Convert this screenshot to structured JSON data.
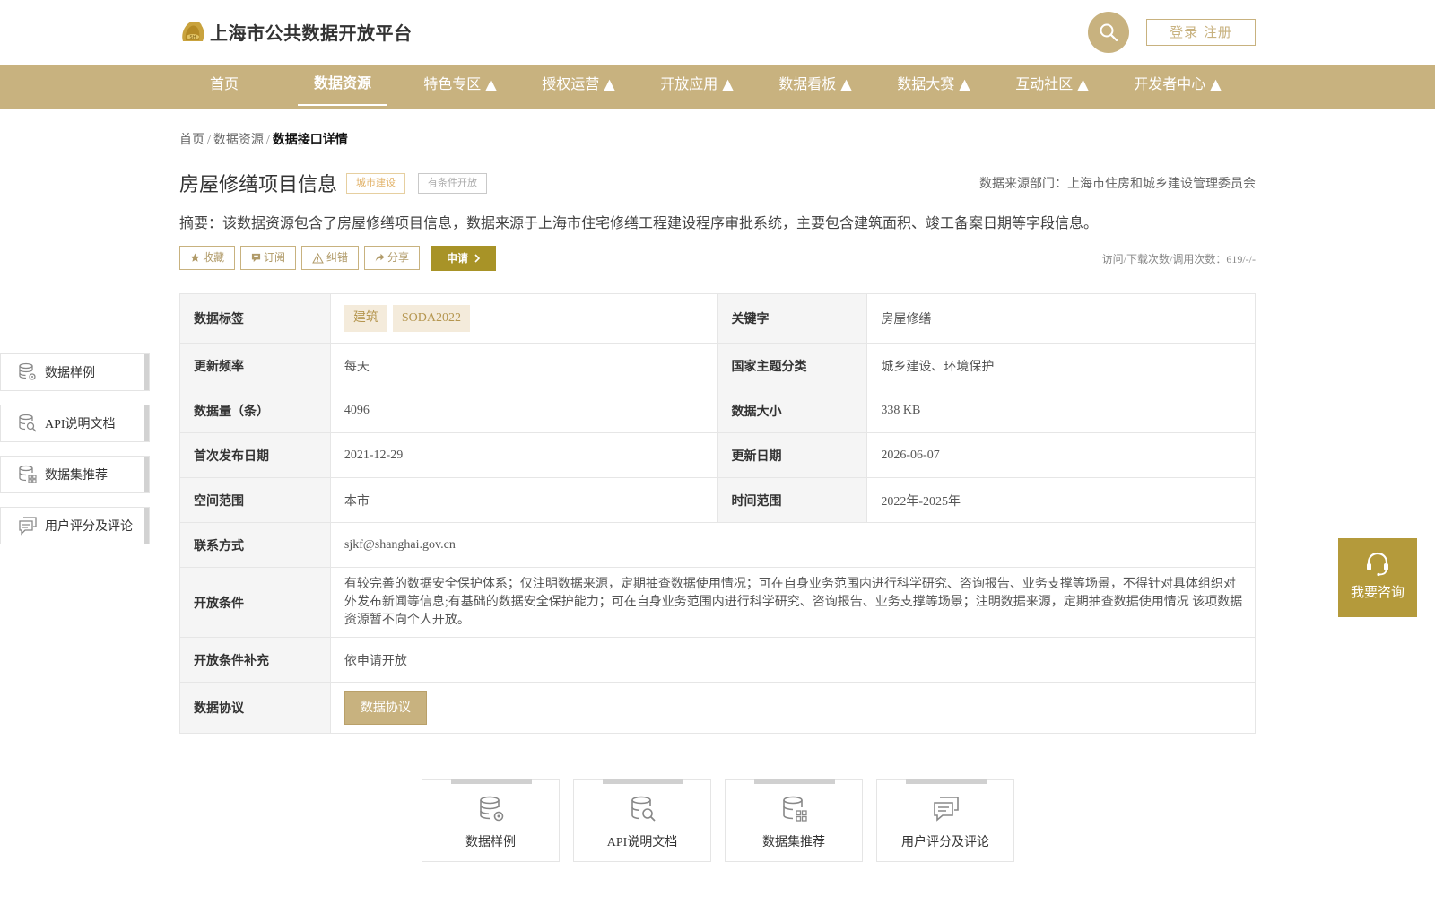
{
  "header": {
    "site_title": "上海市公共数据开放平台",
    "login_label": "登录 注册"
  },
  "nav": {
    "items": [
      "首页",
      "数据资源",
      "特色专区 ▲",
      "授权运营 ▲",
      "开放应用 ▲",
      "数据看板 ▲",
      "数据大赛 ▲",
      "互动社区 ▲",
      "开发者中心 ▲"
    ],
    "active": "数据资源"
  },
  "breadcrumb": {
    "home": "首页",
    "sep": "/",
    "section": "数据资源",
    "current": "数据接口详情"
  },
  "dataset": {
    "title": "房屋修缮项目信息",
    "category_tag": "城市建设",
    "open_tag": "有条件开放",
    "source_dept": "数据来源部门：上海市住房和城乡建设管理委员会",
    "summary": "摘要：该数据资源包含了房屋修缮项目信息，数据来源于上海市住宅修缮工程建设程序审批系统，主要包含建筑面积、竣工备案日期等字段信息。",
    "stats": "访问/下载次数/调用次数：619/-/-"
  },
  "actions": {
    "favorite": "收藏",
    "subscribe": "订阅",
    "correct": "纠错",
    "share": "分享",
    "apply": "申请"
  },
  "info": {
    "tags_label": "数据标签",
    "tags": [
      "建筑",
      "SODA2022"
    ],
    "keyword_label": "关键字",
    "keyword": "房屋修缮",
    "freq_label": "更新频率",
    "freq": "每天",
    "theme_label": "国家主题分类",
    "theme": "城乡建设、环境保护",
    "count_label": "数据量（条）",
    "count": "4096",
    "size_label": "数据大小",
    "size": "338 KB",
    "first_pub_label": "首次发布日期",
    "first_pub": "2021-12-29",
    "update_label": "更新日期",
    "update": "2026-06-07",
    "space_label": "空间范围",
    "space": "本市",
    "time_label": "时间范围",
    "time": "2022年-2025年",
    "contact_label": "联系方式",
    "contact": "sjkf@shanghai.gov.cn",
    "cond_label": "开放条件",
    "cond": "有较完善的数据安全保护体系；仅注明数据来源，定期抽查数据使用情况；可在自身业务范围内进行科学研究、咨询报告、业务支撑等场景，不得针对具体组织对外发布新闻等信息;有基础的数据安全保护能力；可在自身业务范围内进行科学研究、咨询报告、业务支撑等场景；注明数据来源，定期抽查数据使用情况 该项数据资源暂不向个人开放。",
    "cond_extra_label": "开放条件补充",
    "cond_extra": "依申请开放",
    "protocol_label": "数据协议",
    "protocol_button": "数据协议"
  },
  "side_menu": {
    "sample": "数据样例",
    "api_doc": "API说明文档",
    "recommend": "数据集推荐",
    "comments": "用户评分及评论"
  },
  "consult": {
    "label": "我要咨询"
  },
  "bottom_cards": {
    "sample": "数据样例",
    "api_doc": "API说明文档",
    "recommend": "数据集推荐",
    "comments": "用户评分及评论"
  },
  "colors": {
    "brand_gold": "#c8b27f",
    "apply_olive": "#a89327",
    "consult_gold": "#b49a3b",
    "tag_orange": "#e2b36a"
  }
}
